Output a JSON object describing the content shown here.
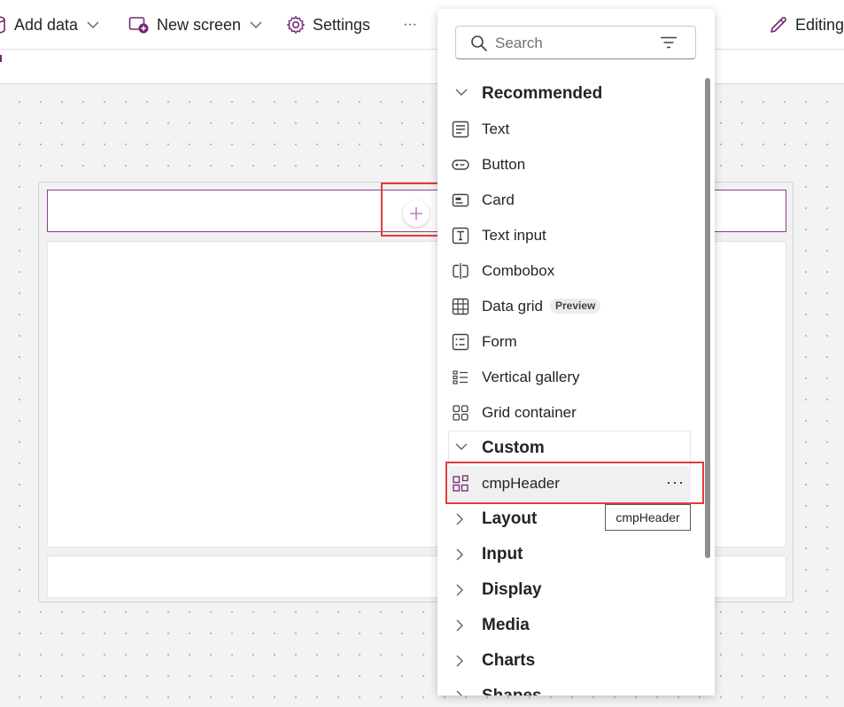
{
  "toolbar": {
    "add_data": "Add data",
    "new_screen": "New screen",
    "settings": "Settings",
    "more": "···",
    "editing": "Editing"
  },
  "search": {
    "placeholder": "Search"
  },
  "sections": {
    "recommended": "Recommended",
    "custom": "Custom"
  },
  "recommended_items": [
    "Text",
    "Button",
    "Card",
    "Text input",
    "Combobox",
    "Data grid",
    "Form",
    "Vertical gallery",
    "Grid container"
  ],
  "badge_preview": "Preview",
  "custom_items": [
    "cmpHeader"
  ],
  "collapsed_sections": [
    "Layout",
    "Input",
    "Display",
    "Media",
    "Charts",
    "Shapes"
  ],
  "tooltip": "cmpHeader",
  "colors": {
    "accent": "#742774",
    "highlight": "#e33b3b"
  }
}
